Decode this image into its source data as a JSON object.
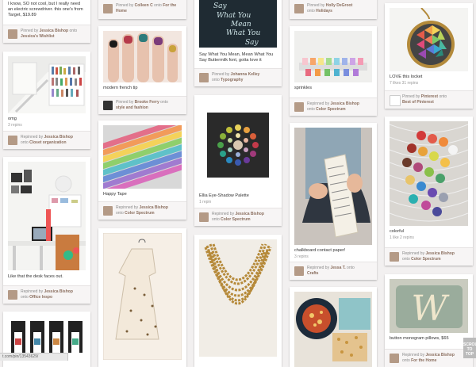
{
  "pins": [
    {
      "desc": "I know, SO not cool, but I really need an electric screwdriver. this one's from Target, $19.89",
      "pinned_prefix": "Pinned by",
      "user": "Jessica Bishop",
      "mid": "onto",
      "board": "Jessica's Wishlist"
    },
    {
      "desc": "omg",
      "repins": "3 repins",
      "pinned_prefix": "Repinned by",
      "user": "Jessica Bishop",
      "mid": "onto",
      "board": "Closet organization"
    },
    {
      "desc": "Like that the desk faces out.",
      "pinned_prefix": "Repinned by",
      "user": "Jessica Bishop",
      "mid": "onto",
      "board": "Office Inspo"
    },
    {
      "pinned_prefix": "Pinned by",
      "user": "Colleen C",
      "mid": "onto",
      "board": "For the Home"
    },
    {
      "desc": "modern french tip",
      "pinned_prefix": "Pinned by",
      "user": "Brooke Ferry",
      "mid": "onto",
      "board": "style and fashion"
    },
    {
      "desc": "Happy Tape",
      "pinned_prefix": "Repinned by",
      "user": "Jessica Bishop",
      "mid": "onto",
      "board": "Color Spectrum"
    },
    {
      "desc": "Say What You Mean, Mean What You Say Buttermilk font, gotta love it",
      "pinned_prefix": "Pinned by",
      "user": "Johanna Kelley",
      "mid": "onto",
      "board": "Typography"
    },
    {
      "desc": "Ellia Eye-Shadow Palette",
      "repins": "1 repin",
      "pinned_prefix": "Repinned by",
      "user": "Jessica Bishop",
      "mid": "onto",
      "board": "Color Spectrum"
    },
    {
      "pinned_prefix": "Pinned by",
      "user": "Holly DeGroot",
      "mid": "onto",
      "board": "Holidays"
    },
    {
      "desc": "sprinkles",
      "pinned_prefix": "Repinned by",
      "user": "Jessica Bishop",
      "mid": "onto",
      "board": "Color Spectrum"
    },
    {
      "desc": "chalkboard contact paper!",
      "repins": "3 repins",
      "pinned_prefix": "Repinned by",
      "user": "Jessa T.",
      "mid": "onto",
      "board": "Crafts"
    },
    {
      "desc": "LOVE this locket",
      "repins": "7 likes   31 repins",
      "pinned_prefix": "Pinned by",
      "user": "Pinterest",
      "mid": "onto",
      "board": "Best of Pinterest"
    },
    {
      "desc": "colorful",
      "repins": "1 like   2 repins",
      "pinned_prefix": "Repinned by",
      "user": "Jessica Bishop",
      "mid": "onto",
      "board": "Color Spectrum"
    },
    {
      "desc": "button monogram pillows, $65",
      "pinned_prefix": "Repinned by",
      "user": "Jessica Bishop",
      "mid": "onto",
      "board": "For the Home"
    }
  ],
  "art": {
    "typography_poster": [
      "Say",
      "What You",
      "Mean",
      "What You",
      "Say"
    ],
    "monogram_letter": "W"
  },
  "status_url": "t.com/pin/13543629/",
  "scroll_top_label": "SCROLL TO TOP",
  "colors": {
    "background": "#f2f0f0",
    "link": "#8a6e5e",
    "meta": "#8a8a8a"
  }
}
